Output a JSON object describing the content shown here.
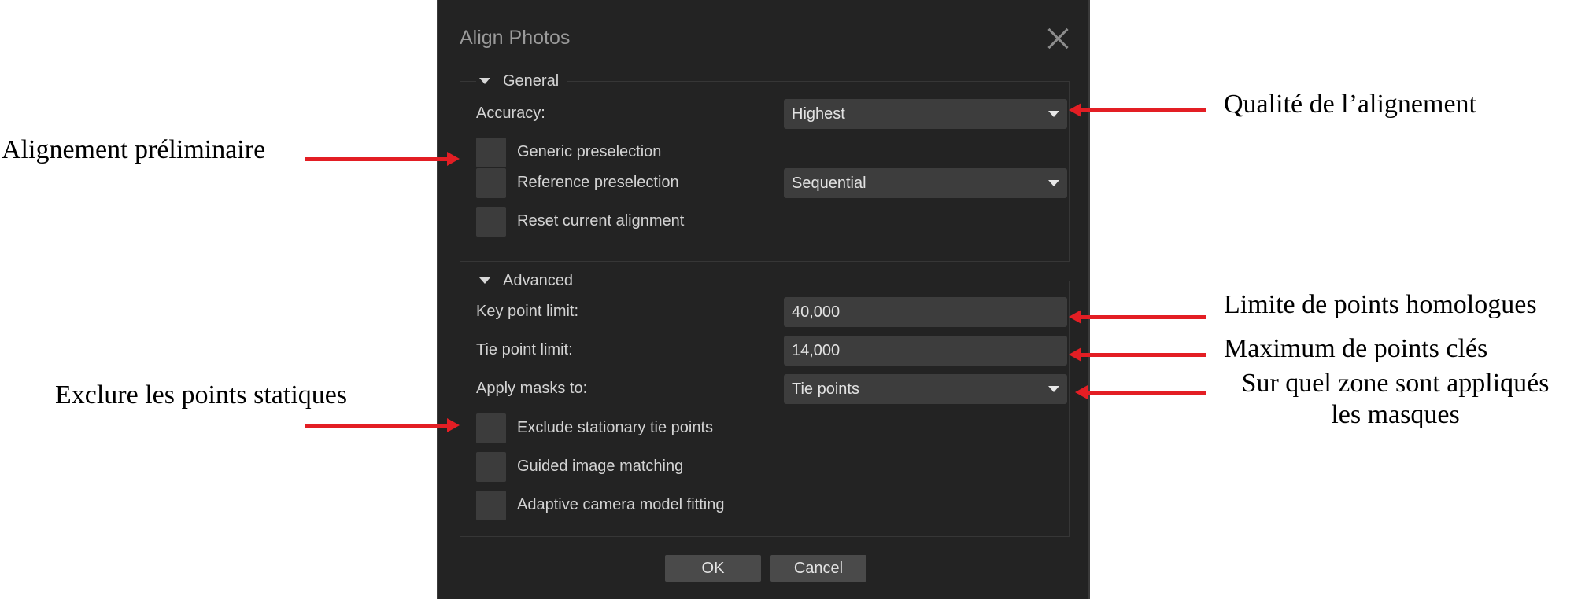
{
  "dialog": {
    "title": "Align Photos",
    "general": {
      "heading": "General",
      "accuracy_label": "Accuracy:",
      "accuracy_value": "Highest",
      "generic_preselection_label": "Generic preselection",
      "reference_preselection_label": "Reference preselection",
      "reference_preselection_value": "Sequential",
      "reset_alignment_label": "Reset current alignment"
    },
    "advanced": {
      "heading": "Advanced",
      "key_point_limit_label": "Key point limit:",
      "key_point_limit_value": "40,000",
      "tie_point_limit_label": "Tie point limit:",
      "tie_point_limit_value": "14,000",
      "apply_masks_label": "Apply masks to:",
      "apply_masks_value": "Tie points",
      "exclude_stationary_label": "Exclude stationary tie points",
      "guided_matching_label": "Guided image matching",
      "adaptive_fitting_label": "Adaptive camera model fitting"
    },
    "buttons": {
      "ok": "OK",
      "cancel": "Cancel"
    }
  },
  "annotations": {
    "alignment_quality": "Qualité de l’alignement",
    "preliminary_alignment": "Alignement préliminaire",
    "homologous_point_limit": "Limite de points homologues",
    "max_key_points": "Maximum de points clés",
    "masks_zone_line1": "Sur quel zone sont appliqués",
    "masks_zone_line2": "les masques",
    "exclude_static_points": "Exclure les points statiques"
  },
  "colors": {
    "arrow": "#e31e24",
    "dialog_bg": "#232323",
    "field_bg": "#3d3d3d"
  }
}
